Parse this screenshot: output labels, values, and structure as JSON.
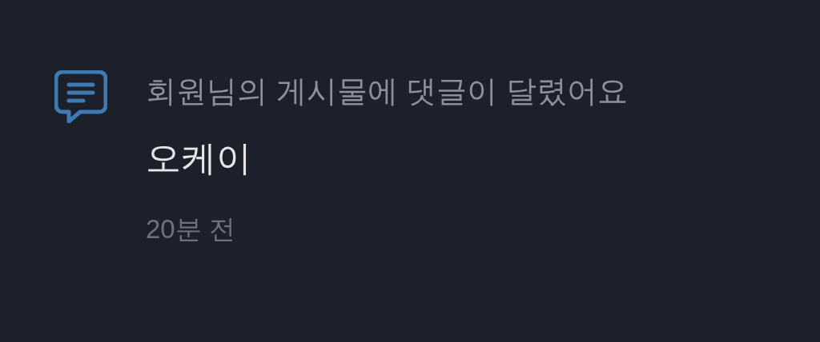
{
  "notification": {
    "title": "회원님의 게시물에 댓글이 달렸어요",
    "message": "오케이",
    "time": "20분 전"
  }
}
